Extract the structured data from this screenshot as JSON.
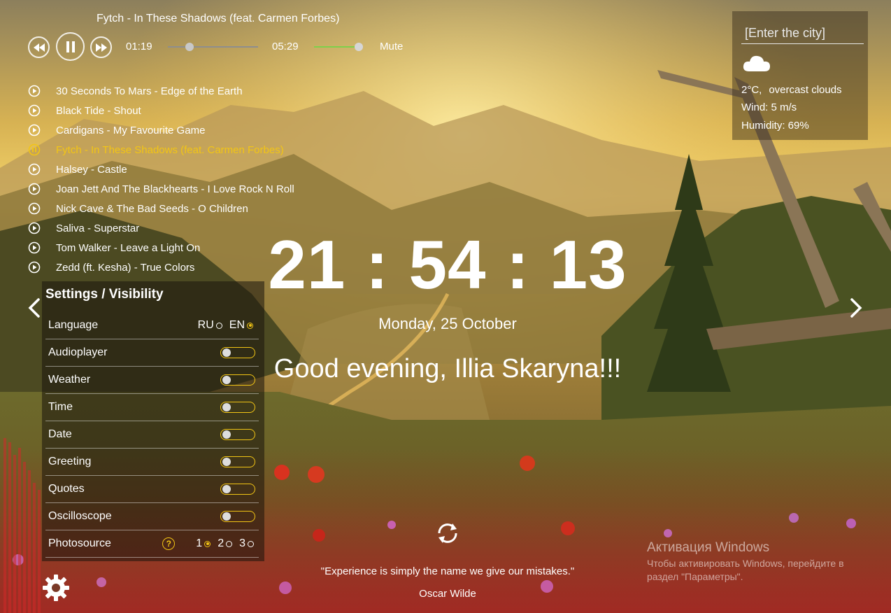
{
  "player": {
    "now_playing": "Fytch - In These Shadows (feat. Carmen Forbes)",
    "current_time": "01:19",
    "duration": "05:29",
    "progress": 0.24,
    "volume": 1.0,
    "mute_label": "Mute",
    "colors": {
      "active": "#f2c515",
      "volume_fill": "#7ed04b"
    },
    "playlist": [
      {
        "title": "30 Seconds To Mars - Edge of the Earth",
        "state": "play-icon"
      },
      {
        "title": "Black Tide - Shout",
        "state": "play-icon"
      },
      {
        "title": "Cardigans - My Favourite Game",
        "state": "play-icon"
      },
      {
        "title": "Fytch - In These Shadows (feat. Carmen Forbes)",
        "state": "pause-icon"
      },
      {
        "title": "Halsey - Castle",
        "state": "play-icon"
      },
      {
        "title": "Joan Jett And The Blackhearts - I Love Rock N Roll",
        "state": "play-icon"
      },
      {
        "title": "Nick Cave & The Bad Seeds - O Children",
        "state": "play-icon"
      },
      {
        "title": "Saliva - Superstar",
        "state": "play-icon"
      },
      {
        "title": "Tom Walker - Leave a Light On",
        "state": "play-icon"
      },
      {
        "title": "Zedd (ft. Kesha) - True Colors",
        "state": "play-icon"
      }
    ]
  },
  "weather": {
    "city_placeholder": "[Enter the city]",
    "icon": "cloud-icon",
    "temperature": "2°C,",
    "description": "overcast clouds",
    "wind": "Wind: 5 m/s",
    "humidity": "Humidity: 69%"
  },
  "clock": {
    "time": "21 : 54 : 13",
    "date": "Monday, 25 October",
    "greeting": "Good evening,  Illia Skaryna!!!"
  },
  "quote": {
    "text": "\"Experience is simply the name we give our mistakes.\"",
    "author": "Oscar Wilde"
  },
  "settings": {
    "title": "Settings / Visibility",
    "language": {
      "label": "Language",
      "options": [
        {
          "label": "RU",
          "selected": false
        },
        {
          "label": "EN",
          "selected": true
        }
      ]
    },
    "toggles": [
      {
        "label": "Audioplayer",
        "on": false
      },
      {
        "label": "Weather",
        "on": false
      },
      {
        "label": "Time",
        "on": false
      },
      {
        "label": "Date",
        "on": false
      },
      {
        "label": "Greeting",
        "on": false
      },
      {
        "label": "Quotes",
        "on": false
      },
      {
        "label": "Oscilloscope",
        "on": false
      }
    ],
    "photosource": {
      "label": "Photosource",
      "help": "?",
      "options": [
        {
          "label": "1",
          "selected": true
        },
        {
          "label": "2",
          "selected": false
        },
        {
          "label": "3",
          "selected": false
        }
      ]
    }
  },
  "windows_watermark": {
    "title": "Активация Windows",
    "subtitle": "Чтобы активировать Windows, перейдите в раздел \"Параметры\"."
  }
}
